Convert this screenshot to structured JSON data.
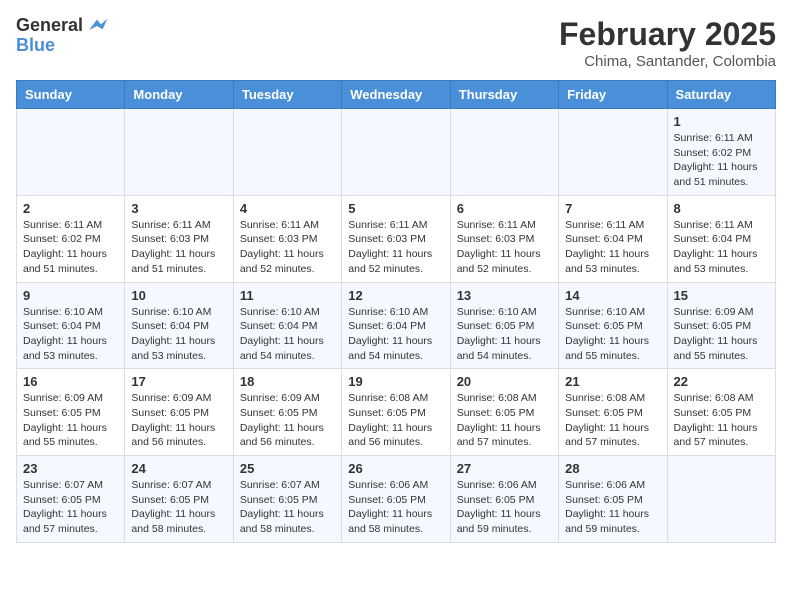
{
  "header": {
    "logo": {
      "line1": "General",
      "line2": "Blue"
    },
    "month_year": "February 2025",
    "location": "Chima, Santander, Colombia"
  },
  "days_of_week": [
    "Sunday",
    "Monday",
    "Tuesday",
    "Wednesday",
    "Thursday",
    "Friday",
    "Saturday"
  ],
  "weeks": [
    [
      {
        "day": "",
        "info": ""
      },
      {
        "day": "",
        "info": ""
      },
      {
        "day": "",
        "info": ""
      },
      {
        "day": "",
        "info": ""
      },
      {
        "day": "",
        "info": ""
      },
      {
        "day": "",
        "info": ""
      },
      {
        "day": "1",
        "info": "Sunrise: 6:11 AM\nSunset: 6:02 PM\nDaylight: 11 hours and 51 minutes."
      }
    ],
    [
      {
        "day": "2",
        "info": "Sunrise: 6:11 AM\nSunset: 6:02 PM\nDaylight: 11 hours and 51 minutes."
      },
      {
        "day": "3",
        "info": "Sunrise: 6:11 AM\nSunset: 6:03 PM\nDaylight: 11 hours and 51 minutes."
      },
      {
        "day": "4",
        "info": "Sunrise: 6:11 AM\nSunset: 6:03 PM\nDaylight: 11 hours and 52 minutes."
      },
      {
        "day": "5",
        "info": "Sunrise: 6:11 AM\nSunset: 6:03 PM\nDaylight: 11 hours and 52 minutes."
      },
      {
        "day": "6",
        "info": "Sunrise: 6:11 AM\nSunset: 6:03 PM\nDaylight: 11 hours and 52 minutes."
      },
      {
        "day": "7",
        "info": "Sunrise: 6:11 AM\nSunset: 6:04 PM\nDaylight: 11 hours and 53 minutes."
      },
      {
        "day": "8",
        "info": "Sunrise: 6:11 AM\nSunset: 6:04 PM\nDaylight: 11 hours and 53 minutes."
      }
    ],
    [
      {
        "day": "9",
        "info": "Sunrise: 6:10 AM\nSunset: 6:04 PM\nDaylight: 11 hours and 53 minutes."
      },
      {
        "day": "10",
        "info": "Sunrise: 6:10 AM\nSunset: 6:04 PM\nDaylight: 11 hours and 53 minutes."
      },
      {
        "day": "11",
        "info": "Sunrise: 6:10 AM\nSunset: 6:04 PM\nDaylight: 11 hours and 54 minutes."
      },
      {
        "day": "12",
        "info": "Sunrise: 6:10 AM\nSunset: 6:04 PM\nDaylight: 11 hours and 54 minutes."
      },
      {
        "day": "13",
        "info": "Sunrise: 6:10 AM\nSunset: 6:05 PM\nDaylight: 11 hours and 54 minutes."
      },
      {
        "day": "14",
        "info": "Sunrise: 6:10 AM\nSunset: 6:05 PM\nDaylight: 11 hours and 55 minutes."
      },
      {
        "day": "15",
        "info": "Sunrise: 6:09 AM\nSunset: 6:05 PM\nDaylight: 11 hours and 55 minutes."
      }
    ],
    [
      {
        "day": "16",
        "info": "Sunrise: 6:09 AM\nSunset: 6:05 PM\nDaylight: 11 hours and 55 minutes."
      },
      {
        "day": "17",
        "info": "Sunrise: 6:09 AM\nSunset: 6:05 PM\nDaylight: 11 hours and 56 minutes."
      },
      {
        "day": "18",
        "info": "Sunrise: 6:09 AM\nSunset: 6:05 PM\nDaylight: 11 hours and 56 minutes."
      },
      {
        "day": "19",
        "info": "Sunrise: 6:08 AM\nSunset: 6:05 PM\nDaylight: 11 hours and 56 minutes."
      },
      {
        "day": "20",
        "info": "Sunrise: 6:08 AM\nSunset: 6:05 PM\nDaylight: 11 hours and 57 minutes."
      },
      {
        "day": "21",
        "info": "Sunrise: 6:08 AM\nSunset: 6:05 PM\nDaylight: 11 hours and 57 minutes."
      },
      {
        "day": "22",
        "info": "Sunrise: 6:08 AM\nSunset: 6:05 PM\nDaylight: 11 hours and 57 minutes."
      }
    ],
    [
      {
        "day": "23",
        "info": "Sunrise: 6:07 AM\nSunset: 6:05 PM\nDaylight: 11 hours and 57 minutes."
      },
      {
        "day": "24",
        "info": "Sunrise: 6:07 AM\nSunset: 6:05 PM\nDaylight: 11 hours and 58 minutes."
      },
      {
        "day": "25",
        "info": "Sunrise: 6:07 AM\nSunset: 6:05 PM\nDaylight: 11 hours and 58 minutes."
      },
      {
        "day": "26",
        "info": "Sunrise: 6:06 AM\nSunset: 6:05 PM\nDaylight: 11 hours and 58 minutes."
      },
      {
        "day": "27",
        "info": "Sunrise: 6:06 AM\nSunset: 6:05 PM\nDaylight: 11 hours and 59 minutes."
      },
      {
        "day": "28",
        "info": "Sunrise: 6:06 AM\nSunset: 6:05 PM\nDaylight: 11 hours and 59 minutes."
      },
      {
        "day": "",
        "info": ""
      }
    ]
  ]
}
